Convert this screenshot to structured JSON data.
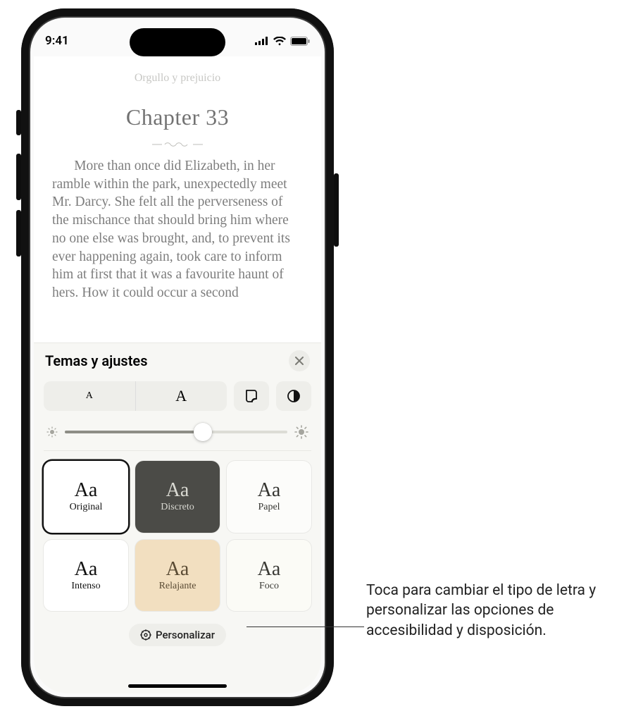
{
  "status": {
    "time": "9:41"
  },
  "book": {
    "title": "Orgullo y prejuicio",
    "chapter": "Chapter 33",
    "paragraph": "More than once did Elizabeth, in her ramble within the park, unexpectedly meet Mr. Darcy. She felt all the perverseness of the mischance that should bring him where no one else was brought, and, to prevent its ever happening again, took care to inform him at first that it was a favourite haunt of hers. How it could occur a second"
  },
  "panel": {
    "title": "Temas y ajustes",
    "font_small_glyph": "A",
    "font_big_glyph": "A",
    "themes": [
      {
        "key": "original",
        "label": "Original",
        "aa": "Aa",
        "selected": true
      },
      {
        "key": "discreto",
        "label": "Discreto",
        "aa": "Aa",
        "selected": false
      },
      {
        "key": "papel",
        "label": "Papel",
        "aa": "Aa",
        "selected": false
      },
      {
        "key": "intenso",
        "label": "Intenso",
        "aa": "Aa",
        "selected": false
      },
      {
        "key": "relajante",
        "label": "Relajante",
        "aa": "Aa",
        "selected": false
      },
      {
        "key": "foco",
        "label": "Foco",
        "aa": "Aa",
        "selected": false
      }
    ],
    "personalize_label": "Personalizar"
  },
  "callout": {
    "text": "Toca para cambiar el tipo de letra y personalizar las opciones de accesibilidad y disposición."
  }
}
